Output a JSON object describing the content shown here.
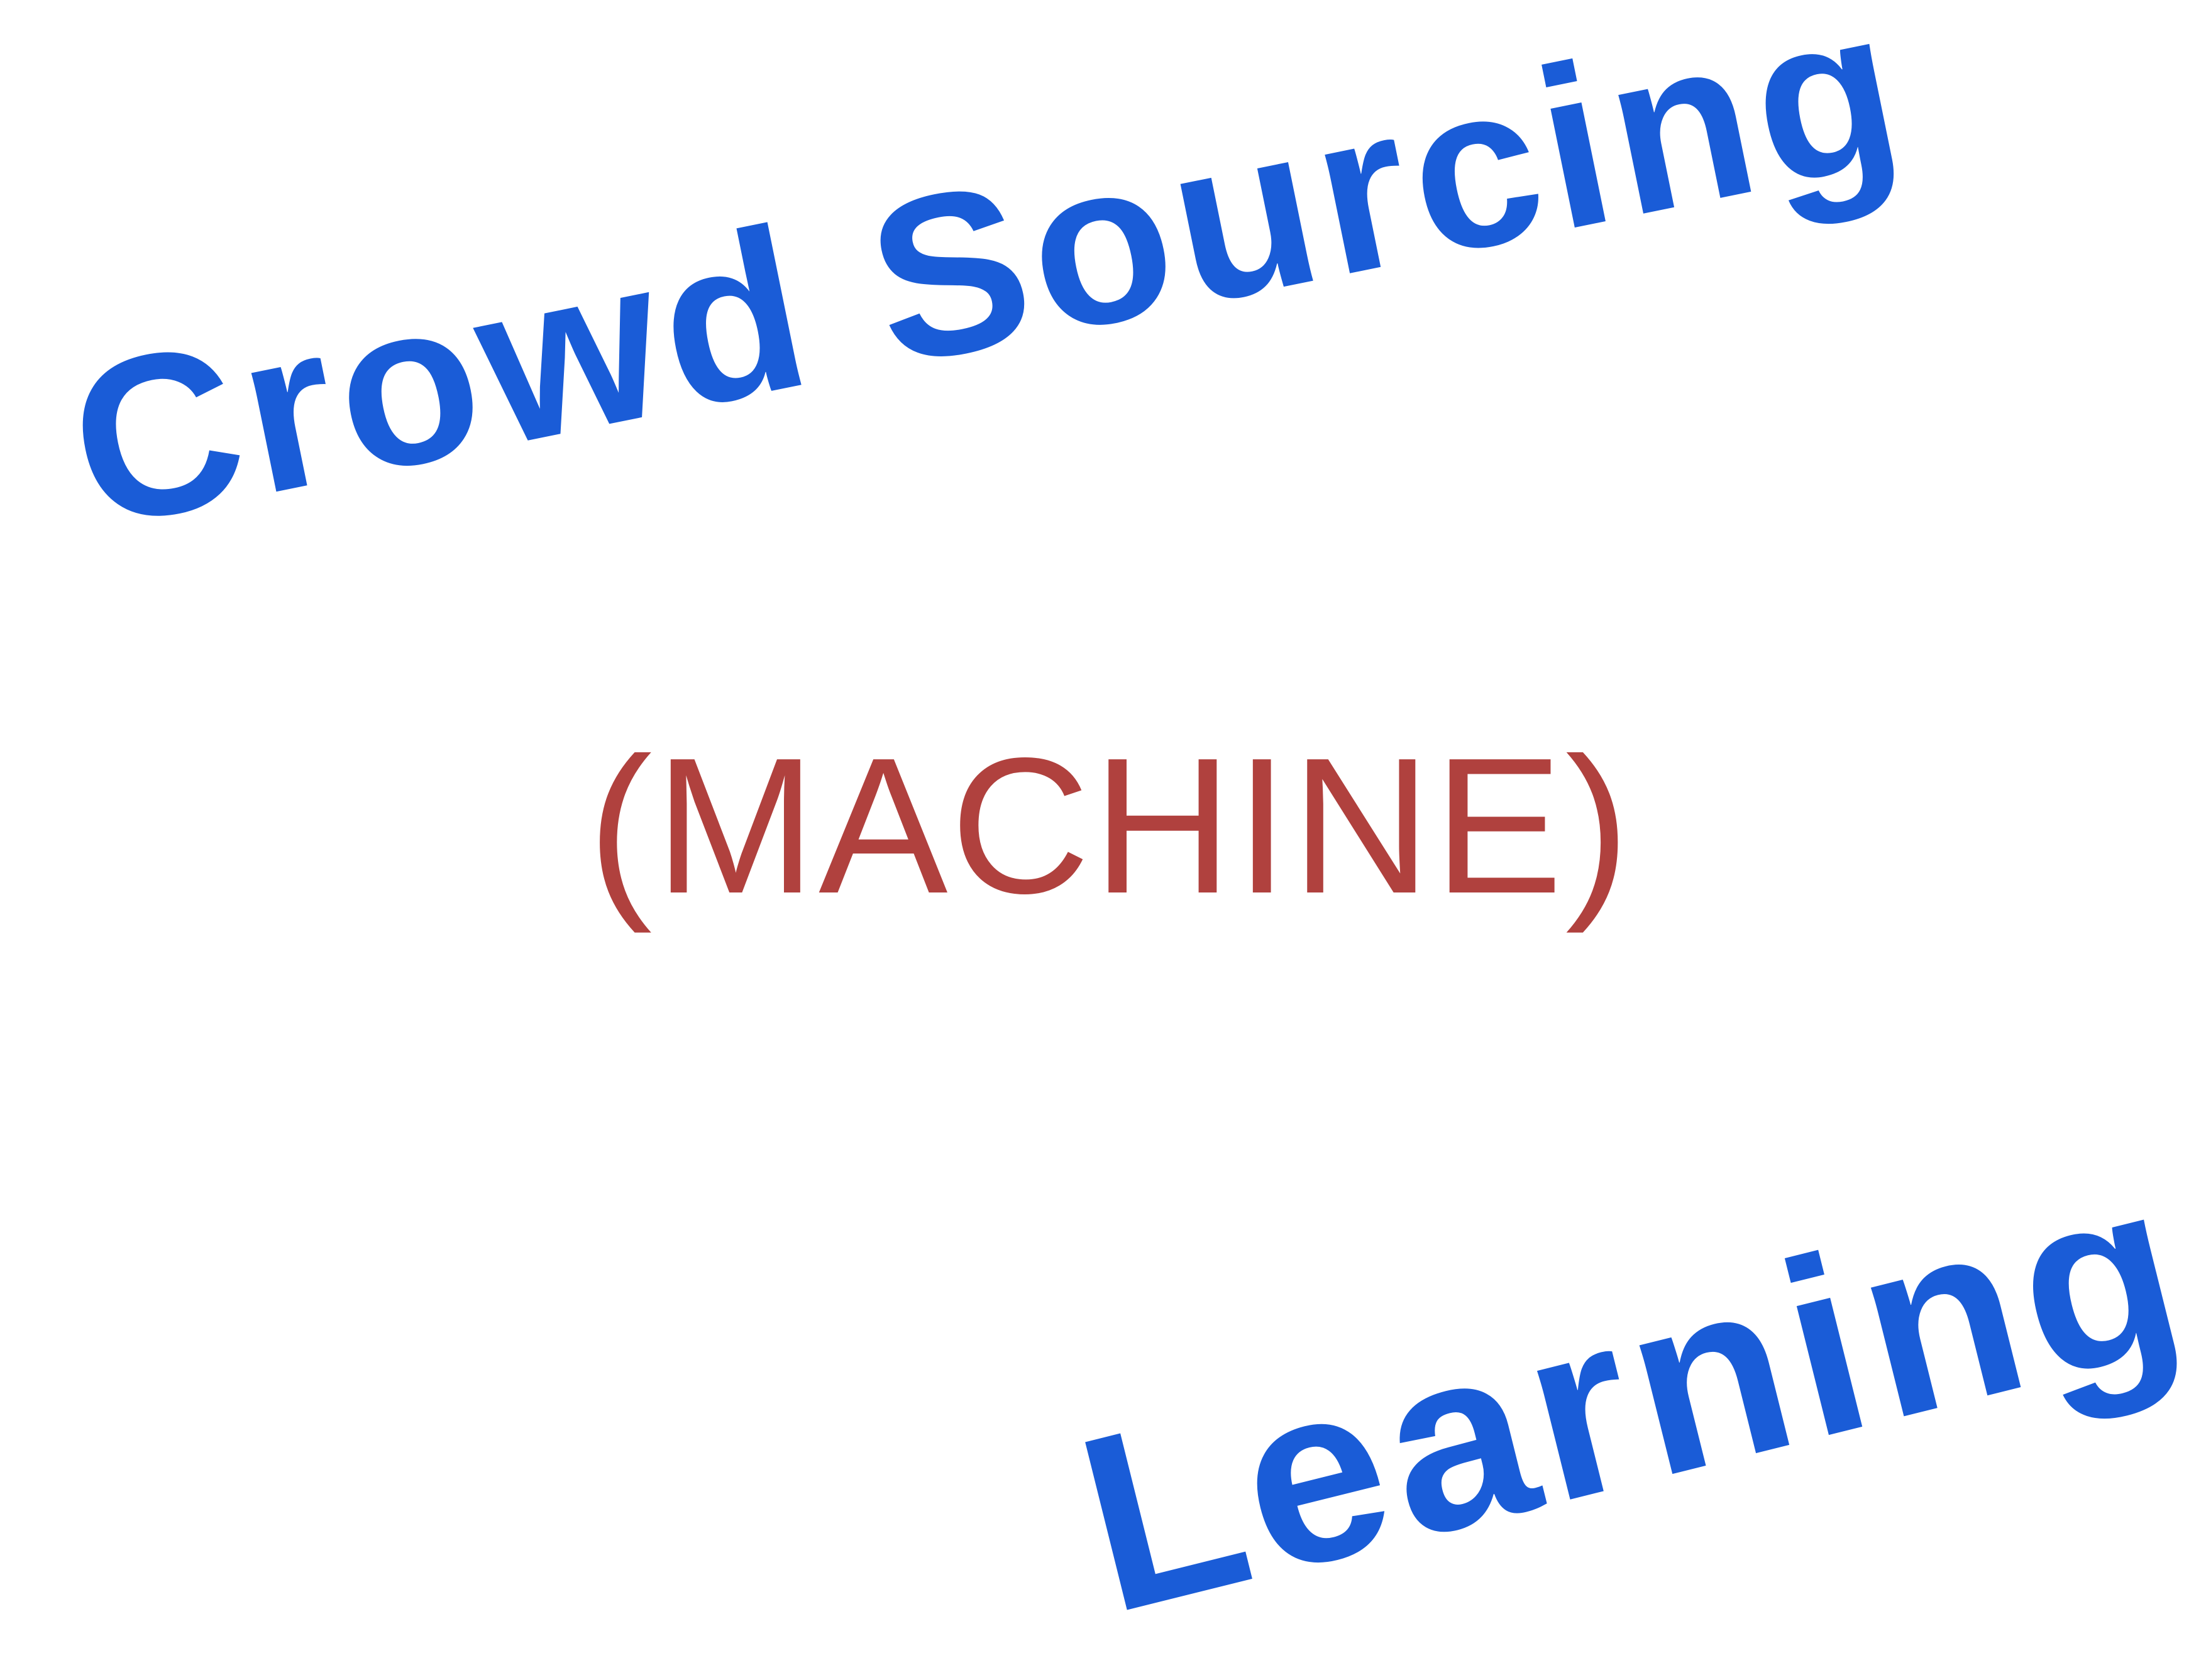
{
  "words": {
    "top": "Crowd Sourcing",
    "middle": "(MACHINE)",
    "bottom": "Learning"
  },
  "colors": {
    "top": "#1a5cd7",
    "middle": "#b0413e",
    "bottom": "#1a5cd7",
    "background": "#ffffff"
  }
}
